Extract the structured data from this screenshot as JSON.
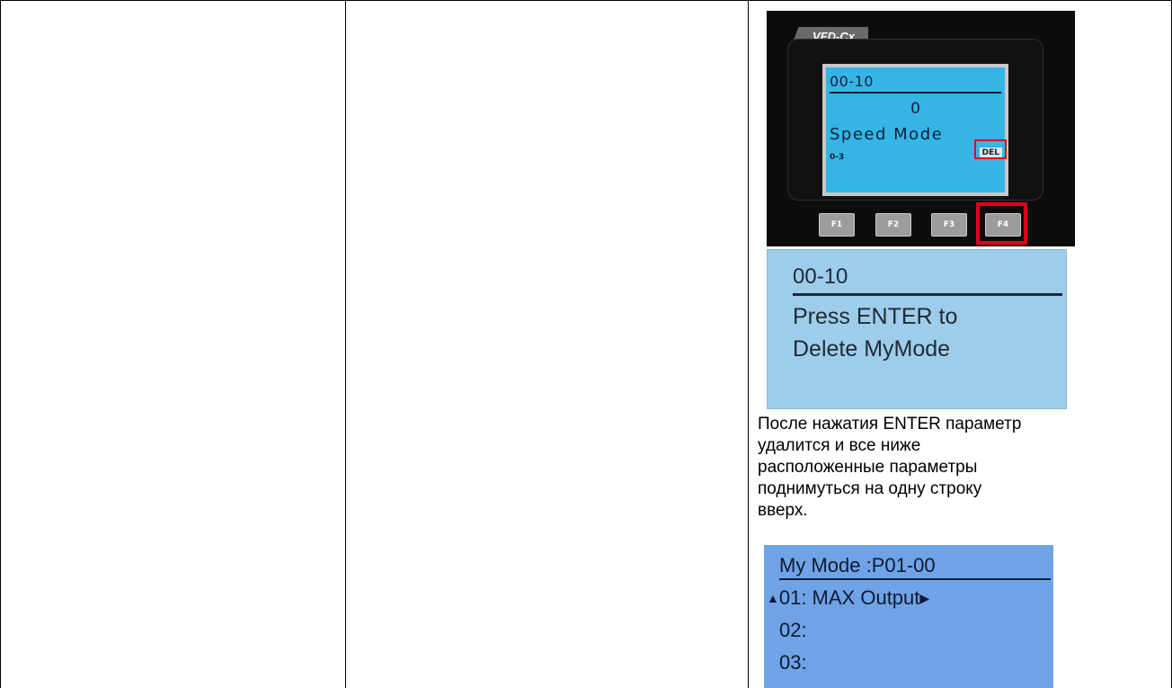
{
  "device": {
    "model_label": "VFD-Cx",
    "lcd": {
      "param": "00-10",
      "value": "0",
      "mode": "Speed Mode",
      "page": "0-3",
      "del_label": "DEL"
    },
    "fkeys": [
      "F1",
      "F2",
      "F3",
      "F4"
    ],
    "highlight_color": "#e0001b",
    "lcd_color": "#35b5e5"
  },
  "confirm_screen": {
    "param": "00-10",
    "line1": "Press ENTER to",
    "line2": "Delete MyMode"
  },
  "description": {
    "lines": [
      "После нажатия ENTER параметр",
      "удалится и все ниже",
      "расположенные параметры",
      "поднимуться на одну строку",
      "вверх."
    ]
  },
  "mymode_screen": {
    "title": "My Mode  :P01-00",
    "rows": [
      "01: MAX Output",
      "02:",
      "03:"
    ]
  }
}
